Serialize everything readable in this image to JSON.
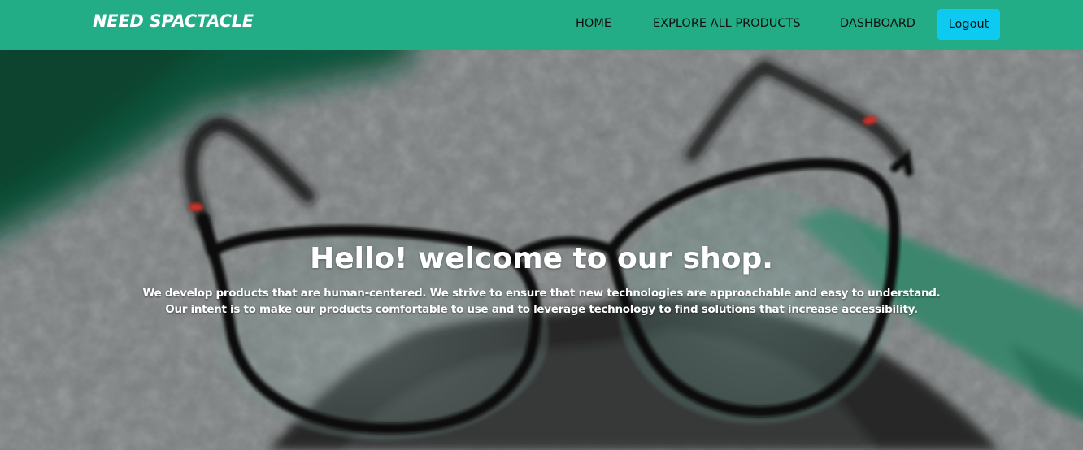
{
  "navbar": {
    "brand": "NEED SPACTACLE",
    "links": [
      "HOME",
      "EXPLORE ALL PRODUCTS",
      "DASHBOARD"
    ],
    "logout_label": "Logout",
    "background_color": "#23ad87",
    "logout_color": "#0dcaf0"
  },
  "hero": {
    "title": "Hello! welcome to our shop.",
    "description_line1": "We develop products that are human-centered. We strive to ensure that new technologies are approachable and easy to understand.",
    "description_line2": "Our intent is to make our products comfortable to use and to leverage technology to find solutions that increase accessibility.",
    "image": "eyeglasses-on-cloth-photo"
  }
}
